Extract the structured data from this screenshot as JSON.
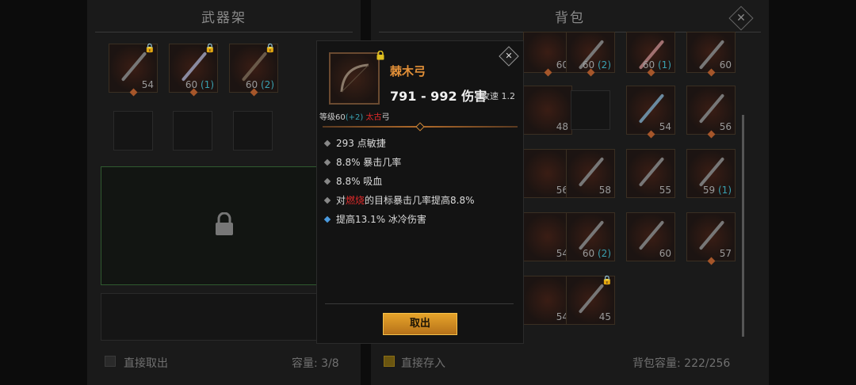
{
  "left_panel": {
    "title": "武器架",
    "slots": [
      {
        "count": "54",
        "plus": ""
      },
      {
        "count": "60",
        "plus": "(1)"
      },
      {
        "count": "60",
        "plus": "(2)"
      }
    ],
    "footer_option": "直接取出",
    "capacity": "容量: 3/8"
  },
  "right_panel": {
    "title": "背包",
    "row1": [
      {
        "count": "60",
        "plus": ""
      },
      {
        "count": "60",
        "plus": "(2)"
      },
      {
        "count": "60",
        "plus": "(1)"
      },
      {
        "count": "60",
        "plus": ""
      }
    ],
    "row2": [
      {
        "count": "48",
        "plus": ""
      },
      {
        "count": "",
        "plus": ""
      },
      {
        "count": "54",
        "plus": ""
      },
      {
        "count": "56",
        "plus": ""
      }
    ],
    "row3": [
      {
        "count": "56",
        "plus": ""
      },
      {
        "count": "58",
        "plus": ""
      },
      {
        "count": "55",
        "plus": ""
      },
      {
        "count": "59",
        "plus": "(1)"
      }
    ],
    "row4": [
      {
        "count": "54",
        "plus": ""
      },
      {
        "count": "60",
        "plus": "(2)"
      },
      {
        "count": "60",
        "plus": ""
      },
      {
        "count": "57",
        "plus": ""
      }
    ],
    "row5": [
      {
        "count": "54",
        "plus": ""
      },
      {
        "count": "45",
        "plus": ""
      }
    ],
    "footer_option": "直接存入",
    "capacity": "背包容量: 222/256"
  },
  "tooltip": {
    "name": "棘木弓",
    "damage": "791 - 992 伤害",
    "speed": "攻速 1.2",
    "level_prefix": "等级60",
    "level_plus": "(+2)",
    "tier": "太古",
    "item_type": "弓",
    "stats": [
      "293 点敏捷",
      "8.8% 暴击几率",
      "8.8% 吸血"
    ],
    "burn_stat": {
      "prefix": "对",
      "highlight": "燃烧",
      "suffix": "的目标暴击几率提高8.8%"
    },
    "special_stat": "提高13.1% 冰冷伤害",
    "button_label": "取出"
  },
  "colors": {
    "accent_orange": "#e39038",
    "plus_blue": "#3aa0b0",
    "tier_red": "#e02a2a",
    "button_gold": "#e7a42a"
  }
}
